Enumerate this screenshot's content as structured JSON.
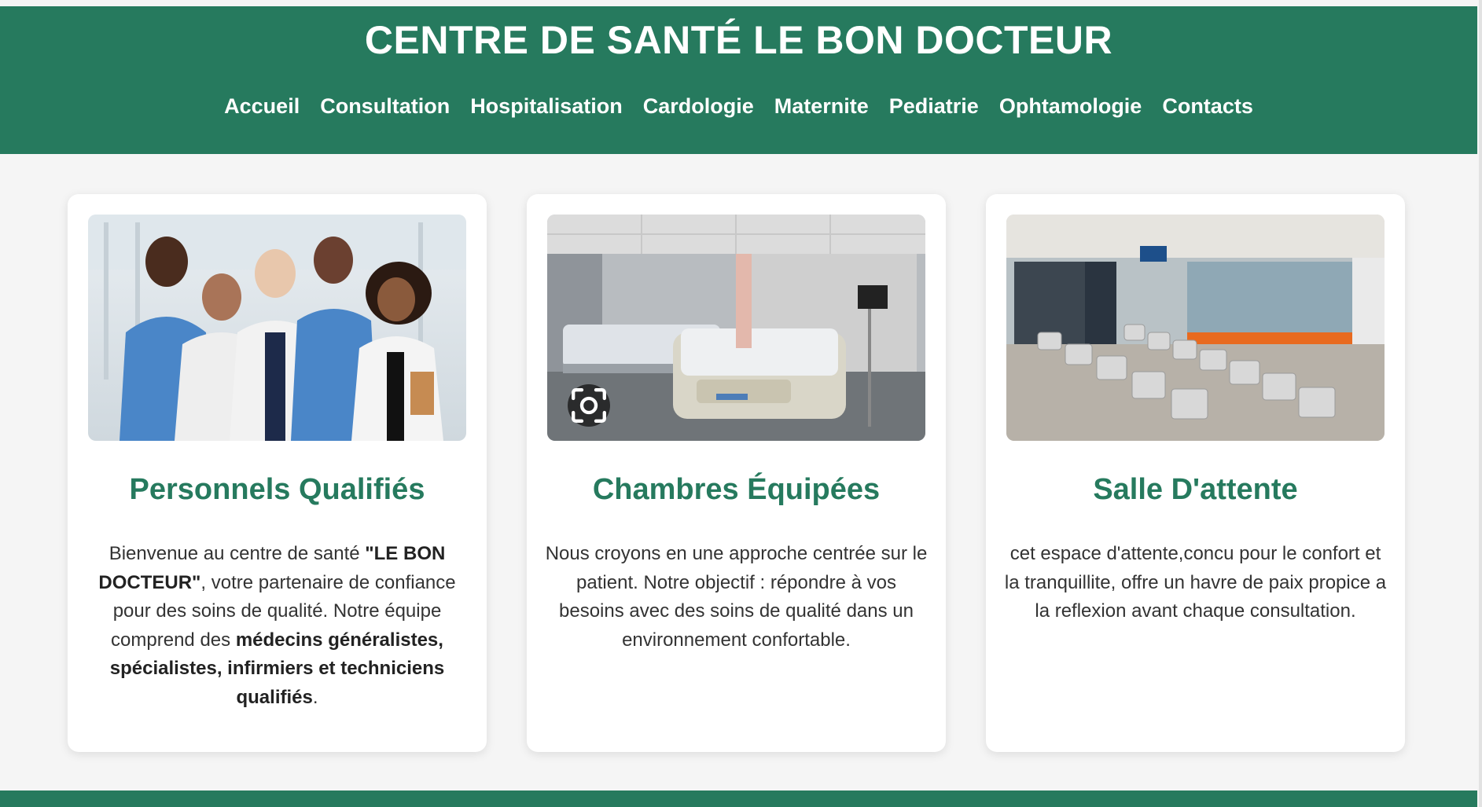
{
  "header": {
    "title": "CENTRE DE SANTÉ LE BON DOCTEUR",
    "nav": [
      {
        "label": "Accueil"
      },
      {
        "label": "Consultation"
      },
      {
        "label": "Hospitalisation"
      },
      {
        "label": "Cardologie"
      },
      {
        "label": "Maternite"
      },
      {
        "label": "Pediatrie"
      },
      {
        "label": "Ophtamologie"
      },
      {
        "label": "Contacts"
      }
    ]
  },
  "cards": [
    {
      "title": "Personnels Qualifiés",
      "image_icon": "medical-team-photo",
      "text_parts": [
        "Bienvenue au centre de santé ",
        "\"LE BON DOCTEUR\"",
        ", votre partenaire de confiance pour des soins de qualité. Notre équipe comprend des ",
        "médecins généralistes, spécialistes, infirmiers et techniciens qualifiés",
        "."
      ]
    },
    {
      "title": "Chambres Équipées",
      "image_icon": "hospital-room-photo",
      "text": "Nous croyons en une approche centrée sur le patient. Notre objectif : répondre à vos besoins avec des soins de qualité dans un environnement confortable."
    },
    {
      "title": "Salle D'attente",
      "image_icon": "waiting-room-photo",
      "text": "cet espace d'attente,concu pour le confort et la tranquillite, offre un havre de paix propice a la reflexion avant chaque consultation."
    }
  ],
  "colors": {
    "primary": "#267a5e",
    "background": "#f5f5f5",
    "card": "#ffffff",
    "text": "#333333"
  }
}
